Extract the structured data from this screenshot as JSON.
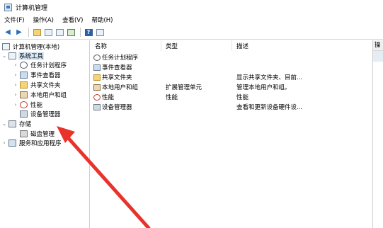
{
  "window": {
    "title": "计算机管理"
  },
  "menubar": {
    "items": [
      "文件(F)",
      "操作(A)",
      "查看(V)",
      "帮助(H)"
    ]
  },
  "toolbar": {
    "icons": [
      "back-arrow-icon",
      "forward-arrow-icon",
      "up-folder-icon",
      "show-tree-icon",
      "properties-icon",
      "export-icon",
      "help-icon",
      "console-icon"
    ]
  },
  "tree": {
    "root": "计算机管理(本地)",
    "system_tools": "系统工具",
    "task_scheduler": "任务计划程序",
    "event_viewer": "事件查看器",
    "shared_folders": "共享文件夹",
    "local_users": "本地用户和组",
    "performance": "性能",
    "device_manager": "设备管理器",
    "storage": "存储",
    "disk_management": "磁盘管理",
    "services_apps": "服务和应用程序"
  },
  "list": {
    "columns": [
      "名称",
      "类型",
      "描述"
    ],
    "rows": [
      {
        "name": "任务计划程序",
        "type": "",
        "desc": "",
        "icon": "clock-icon"
      },
      {
        "name": "事件查看器",
        "type": "",
        "desc": "",
        "icon": "event-log-icon"
      },
      {
        "name": "共享文件夹",
        "type": "",
        "desc": "显示共享文件夹、目前...",
        "icon": "folder-icon"
      },
      {
        "name": "本地用户和组",
        "type": "扩展管理单元",
        "desc": "管理本地用户和组。",
        "icon": "users-icon"
      },
      {
        "name": "性能",
        "type": "性能",
        "desc": "性能",
        "icon": "performance-icon"
      },
      {
        "name": "设备管理器",
        "type": "",
        "desc": "查看和更新设备硬件设...",
        "icon": "device-manager-icon"
      }
    ]
  },
  "actions": {
    "header": "操"
  },
  "annotation": {
    "color": "#e8322a"
  }
}
